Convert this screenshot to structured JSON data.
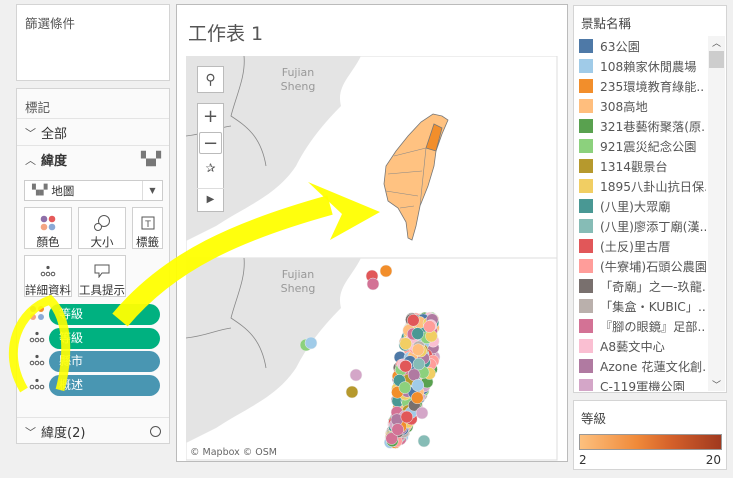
{
  "filters": {
    "title": "篩選條件"
  },
  "marks": {
    "title": "標記",
    "all_label": "全部",
    "latitude_label": "緯度",
    "mark_type": "地圖",
    "buttons": {
      "color": "顏色",
      "size": "大小",
      "label": "標籤",
      "detail": "詳細資料",
      "tooltip": "工具提示"
    },
    "fields": [
      {
        "name": "等級",
        "type": "color",
        "color": "#00b180"
      },
      {
        "name": "等級",
        "type": "detail",
        "color": "#00b180"
      },
      {
        "name": "縣市",
        "type": "detail",
        "color": "#4996b2"
      },
      {
        "name": "概述",
        "type": "detail",
        "color": "#4996b2"
      }
    ],
    "latitude2_label": "緯度(2)"
  },
  "sheet": {
    "title": "工作表 1",
    "map_label_line1": "Fujian",
    "map_label_line2": "Sheng",
    "attribution": "© Mapbox © OSM"
  },
  "legend": {
    "title": "景點名稱",
    "items": [
      {
        "label": "63公園",
        "color": "#4e79a7"
      },
      {
        "label": "108賴家休閒農場",
        "color": "#a0cbe8"
      },
      {
        "label": "235環境教育綠能..",
        "color": "#f28e2b"
      },
      {
        "label": "308高地",
        "color": "#ffbe7d"
      },
      {
        "label": "321巷藝術聚落(原..",
        "color": "#59a14f"
      },
      {
        "label": "921震災紀念公園",
        "color": "#8cd17d"
      },
      {
        "label": "1314觀景台",
        "color": "#b6992d"
      },
      {
        "label": "1895八卦山抗日保..",
        "color": "#f1ce63"
      },
      {
        "label": "(八里)大眾廟",
        "color": "#499894"
      },
      {
        "label": "(八里)廖添丁廟(漢..",
        "color": "#86bcb6"
      },
      {
        "label": "(土反)里古厝",
        "color": "#e15759"
      },
      {
        "label": "(牛寮埔)石頭公農園",
        "color": "#ff9d9a"
      },
      {
        "label": "「奇廟」之一-玖龍..",
        "color": "#79706e"
      },
      {
        "label": "「集盒・KUBIC」..",
        "color": "#bab0ac"
      },
      {
        "label": "『腳の眼鏡』足部..",
        "color": "#d37295"
      },
      {
        "label": "A8藝文中心",
        "color": "#fabfd2"
      },
      {
        "label": "Azone 花蓮文化創..",
        "color": "#b07aa1"
      },
      {
        "label": "C-119軍機公園",
        "color": "#d4a6c8"
      }
    ]
  },
  "grade_legend": {
    "title": "等級",
    "min": "2",
    "max": "20",
    "color_low": "#fdc07e",
    "color_high": "#a0391f"
  },
  "colors": {
    "annotation": "#ffff00",
    "region_fill": "#ffc281",
    "region_highlight": "#f28e2b"
  }
}
